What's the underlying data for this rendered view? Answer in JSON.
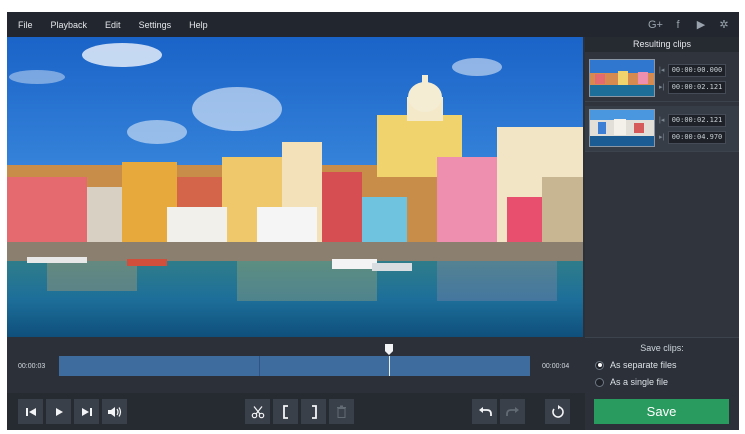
{
  "menu": [
    "File",
    "Playback",
    "Edit",
    "Settings",
    "Help"
  ],
  "social_icons": [
    "google-plus-icon",
    "facebook-icon",
    "youtube-icon",
    "vk-icon"
  ],
  "social_glyphs": [
    "G+",
    "f",
    "▶",
    "✲"
  ],
  "right_panel": {
    "title": "Resulting clips",
    "clips": [
      {
        "start": "00:00:00.000",
        "end": "00:00:02.121"
      },
      {
        "start": "00:00:02.121",
        "end": "00:00:04.970"
      }
    ],
    "start_mark": "|◂",
    "end_mark": "▸|"
  },
  "save": {
    "title": "Save clips:",
    "options": [
      "As separate files",
      "As a single file"
    ],
    "selected": 0,
    "button": "Save"
  },
  "timeline": {
    "start_time": "00:00:03",
    "end_time": "00:00:04"
  },
  "colors": {
    "accent": "#2a9b5f",
    "track": "#3f6c9e"
  }
}
